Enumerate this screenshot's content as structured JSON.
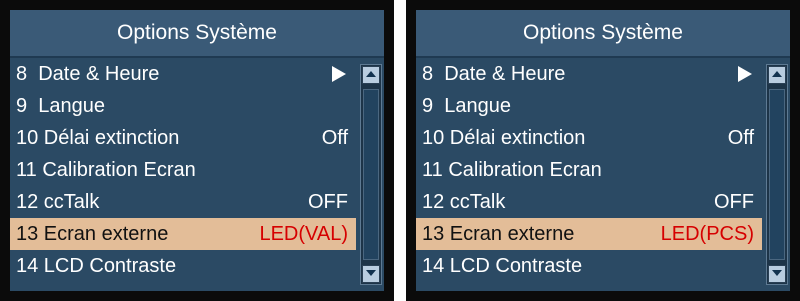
{
  "screens": [
    {
      "title": "Options Système",
      "items": [
        {
          "label": "8  Date & Heure",
          "value": ""
        },
        {
          "label": "9  Langue",
          "value": ""
        },
        {
          "label": "10 Délai extinction",
          "value": "Off"
        },
        {
          "label": "11 Calibration Ecran",
          "value": ""
        },
        {
          "label": "12 ccTalk",
          "value": "OFF"
        },
        {
          "label": "13 Ecran externe",
          "value": "LED(VAL)"
        },
        {
          "label": "14 LCD Contraste",
          "value": ""
        }
      ],
      "selected_index": 5
    },
    {
      "title": "Options Système",
      "items": [
        {
          "label": "8  Date & Heure",
          "value": ""
        },
        {
          "label": "9  Langue",
          "value": ""
        },
        {
          "label": "10 Délai extinction",
          "value": "Off"
        },
        {
          "label": "11 Calibration Ecran",
          "value": ""
        },
        {
          "label": "12 ccTalk",
          "value": "OFF"
        },
        {
          "label": "13 Ecran externe",
          "value": "LED(PCS)"
        },
        {
          "label": "14 LCD Contraste",
          "value": ""
        }
      ],
      "selected_index": 5
    }
  ],
  "icons": {
    "submenu": "right-arrow-icon",
    "scroll_up": "scroll-up-icon",
    "scroll_down": "scroll-down-icon"
  },
  "colors": {
    "panel": "#2b4a64",
    "header": "#3a5a77",
    "selected_bg": "#e3bd98",
    "selected_value": "#d60000"
  }
}
